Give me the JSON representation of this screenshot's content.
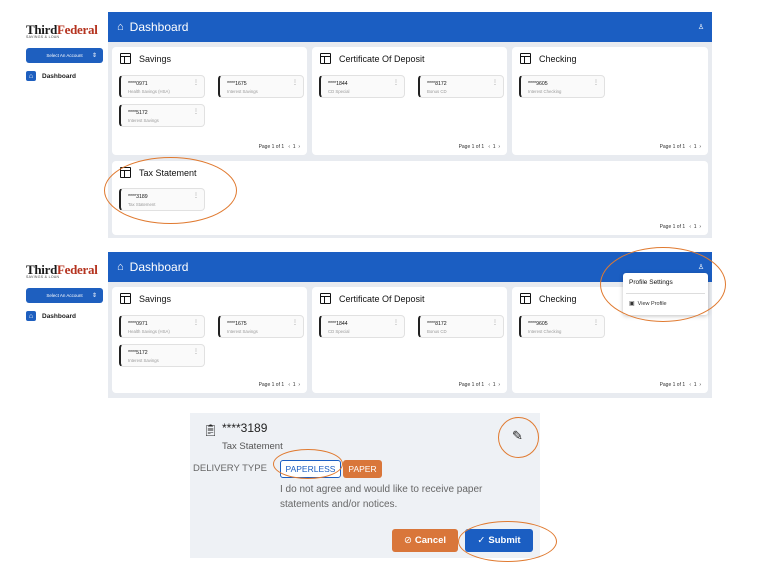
{
  "logo": {
    "third": "Third",
    "federal": "Federal",
    "tagline": "SAVINGS & LOAN"
  },
  "sidebar": {
    "select_account": "Select An Account",
    "dashboard": "Dashboard"
  },
  "header": {
    "title": "Dashboard"
  },
  "panels": {
    "savings": {
      "title": "Savings",
      "accounts": [
        {
          "number": "****0971",
          "label": "Health Savings (HSA)"
        },
        {
          "number": "****1675",
          "label": "Interest Savings"
        },
        {
          "number": "****5172",
          "label": "Interest Savings"
        }
      ]
    },
    "cd": {
      "title": "Certificate Of Deposit",
      "accounts": [
        {
          "number": "****1844",
          "label": "CD Special"
        },
        {
          "number": "****8172",
          "label": "Bonus CD"
        }
      ]
    },
    "checking": {
      "title": "Checking",
      "accounts": [
        {
          "number": "****9605",
          "label": "Interest Checking"
        }
      ]
    },
    "tax": {
      "title": "Tax Statement",
      "accounts": [
        {
          "number": "****3189",
          "label": "Tax Statement"
        }
      ]
    }
  },
  "pager": {
    "text": "Page 1 of 1",
    "page": "1",
    "prev": "‹",
    "next": "›"
  },
  "profile_menu": {
    "settings": "Profile Settings",
    "view": "View Profile"
  },
  "detail": {
    "number": "****3189",
    "label": "Tax Statement",
    "delivery_label": "DELIVERY TYPE",
    "option_paperless": "PAPERLESS",
    "option_paper": "PAPER",
    "message": "I do not agree and would like to receive paper statements and/or notices.",
    "cancel": "Cancel",
    "submit": "Submit"
  },
  "colors": {
    "primary": "#1b5ec2",
    "accent": "#e07a30",
    "paper_tag": "#d9763a"
  }
}
